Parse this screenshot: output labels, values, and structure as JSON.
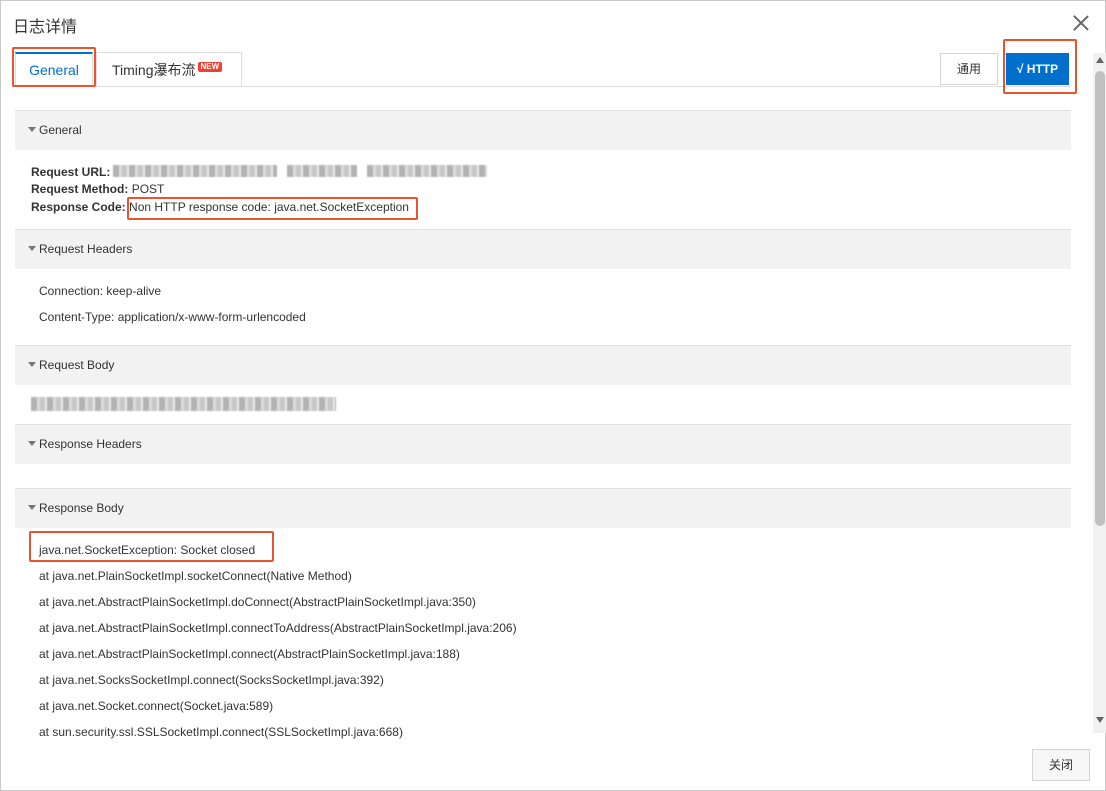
{
  "dialog": {
    "title": "日志详情",
    "close_label": "关闭"
  },
  "tabs": [
    {
      "label": "General",
      "active": true
    },
    {
      "label": "Timing瀑布流",
      "badge": "NEW",
      "active": false
    }
  ],
  "mode_buttons": {
    "general_label": "通用",
    "http_label": "√ HTTP"
  },
  "sections": {
    "general": {
      "title": "General",
      "request_url_label": "Request URL:",
      "request_method_label": "Request Method:",
      "request_method": "POST",
      "response_code_label": "Response Code:",
      "response_code": "Non HTTP response code: java.net.SocketException"
    },
    "request_headers": {
      "title": "Request Headers",
      "lines": [
        "Connection: keep-alive",
        "Content-Type: application/x-www-form-urlencoded"
      ]
    },
    "request_body": {
      "title": "Request Body"
    },
    "response_headers": {
      "title": "Response Headers"
    },
    "response_body": {
      "title": "Response Body",
      "lines": [
        "java.net.SocketException: Socket closed",
        "at java.net.PlainSocketImpl.socketConnect(Native Method)",
        "at java.net.AbstractPlainSocketImpl.doConnect(AbstractPlainSocketImpl.java:350)",
        "at java.net.AbstractPlainSocketImpl.connectToAddress(AbstractPlainSocketImpl.java:206)",
        "at java.net.AbstractPlainSocketImpl.connect(AbstractPlainSocketImpl.java:188)",
        "at java.net.SocksSocketImpl.connect(SocksSocketImpl.java:392)",
        "at java.net.Socket.connect(Socket.java:589)",
        "at sun.security.ssl.SSLSocketImpl.connect(SSLSocketImpl.java:668)"
      ]
    }
  },
  "colors": {
    "accent": "#0070cc",
    "highlight": "#e8542d",
    "badge": "#f04134"
  }
}
